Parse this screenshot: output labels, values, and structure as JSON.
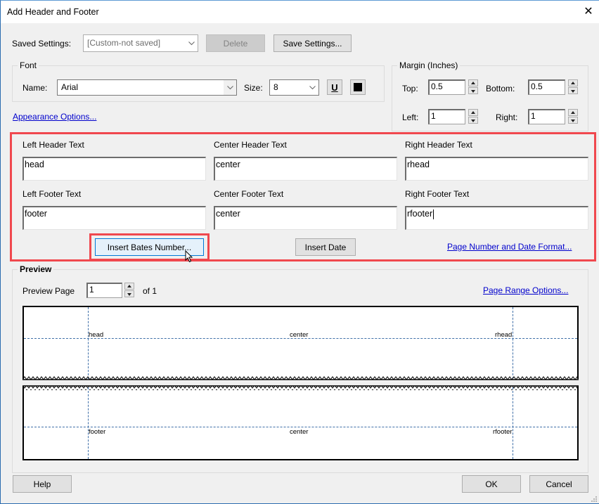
{
  "window": {
    "title": "Add Header and Footer",
    "close_label": "✕"
  },
  "saved_settings": {
    "label": "Saved Settings:",
    "value": "[Custom-not saved]",
    "delete_label": "Delete",
    "save_label": "Save Settings..."
  },
  "font": {
    "group_label": "Font",
    "name_label": "Name:",
    "name_value": "Arial",
    "size_label": "Size:",
    "size_value": "8",
    "underline_label": "U",
    "color": "#000000"
  },
  "appearance_link": "Appearance Options...",
  "margin": {
    "group_label": "Margin (Inches)",
    "top_label": "Top:",
    "top_value": "0.5",
    "bottom_label": "Bottom:",
    "bottom_value": "0.5",
    "left_label": "Left:",
    "left_value": "1",
    "right_label": "Right:",
    "right_value": "1"
  },
  "text_fields": {
    "left_header_label": "Left Header Text",
    "left_header_value": "head",
    "center_header_label": "Center Header Text",
    "center_header_value": "center",
    "right_header_label": "Right Header Text",
    "right_header_value": "rhead",
    "left_footer_label": "Left Footer Text",
    "left_footer_value": "footer",
    "center_footer_label": "Center Footer Text",
    "center_footer_value": "center",
    "right_footer_label": "Right Footer Text",
    "right_footer_value": "rfooter"
  },
  "actions": {
    "insert_bates_label": "Insert Bates Number...",
    "insert_date_label": "Insert Date",
    "page_number_format_link": "Page Number and Date Format..."
  },
  "preview": {
    "group_label": "Preview",
    "page_label": "Preview Page",
    "page_value": "1",
    "of_label": "of 1",
    "page_range_link": "Page Range Options...",
    "header": {
      "left": "head",
      "center": "center",
      "right": "rhead"
    },
    "footer": {
      "left": "footer",
      "center": "center",
      "right": "rfooter"
    }
  },
  "footer_buttons": {
    "help_label": "Help",
    "ok_label": "OK",
    "cancel_label": "Cancel"
  },
  "colors": {
    "highlight": "#f0484e",
    "link": "#0000cc",
    "guide": "#3f6fa8"
  }
}
